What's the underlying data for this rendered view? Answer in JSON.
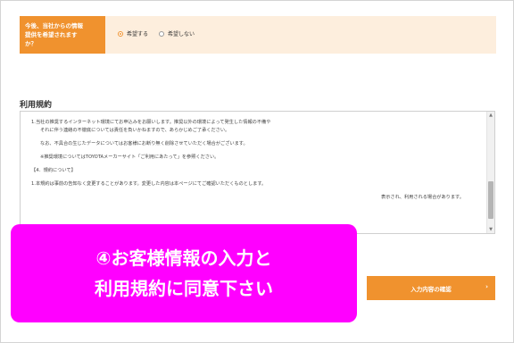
{
  "preference": {
    "label_lines": [
      "今後、当社からの情報",
      "提供を希望されます",
      "か？"
    ],
    "options": [
      {
        "label": "希望する",
        "selected": true
      },
      {
        "label": "希望しない",
        "selected": false
      }
    ]
  },
  "terms": {
    "title": "利用規約",
    "lines": [
      "1.当社の推奨するインターネット環境にてお申込みをお願いします。推奨以外の環境によって発生した情報の不備や",
      "それに伴う連絡の不徹底については責任を負いかねますので、あらかじめご了承ください。",
      "なお、不具合の生じたデータについてはお客様にお断り無く削除させていただく場合がございます。",
      "※推奨環境についてはTOYOTAメーカーサイト「ご利用にあたって」を参照ください。",
      "【4．規約について】",
      "1.本規約は事前の告知なく変更することがあります。変更した内容は本ページにてご確認いただくものとします。",
      "表示され、利用される場合があります。"
    ]
  },
  "callout": {
    "line1": "④お客様情報の入力と",
    "line2": "利用規約に同意下さい"
  },
  "confirm_button": {
    "label": "入力内容の確認",
    "icon": "chevron-right-icon"
  },
  "colors": {
    "accent": "#f0922e",
    "accent_light": "#fdeedd",
    "callout": "#ff00ff"
  }
}
